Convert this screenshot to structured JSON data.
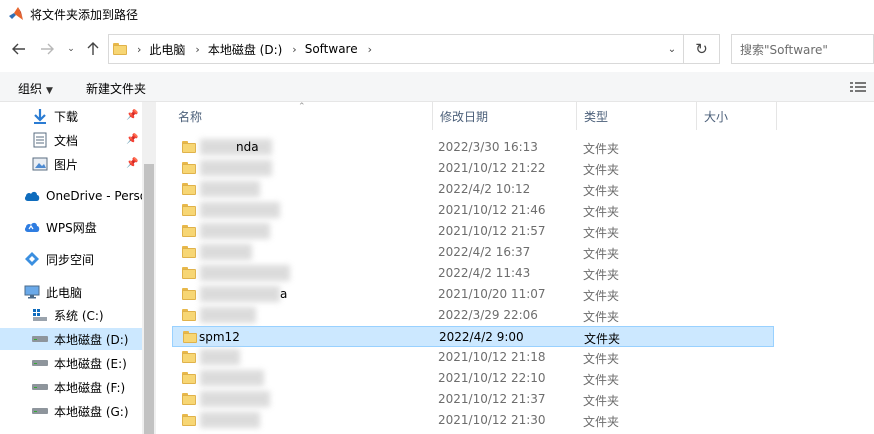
{
  "window": {
    "title": "将文件夹添加到路径"
  },
  "address": {
    "crumbs": [
      "此电脑",
      "本地磁盘 (D:)",
      "Software"
    ],
    "search_placeholder": "搜索\"Software\""
  },
  "toolbar": {
    "organize_label": "组织",
    "new_folder_label": "新建文件夹"
  },
  "nav": {
    "items": [
      {
        "label": "下载",
        "icon": "download-icon",
        "pinned": true
      },
      {
        "label": "文档",
        "icon": "document-icon",
        "pinned": true
      },
      {
        "label": "图片",
        "icon": "picture-icon",
        "pinned": true
      },
      {
        "label": "OneDrive - Perso",
        "icon": "cloud-icon"
      },
      {
        "label": "WPS网盘",
        "icon": "wps-cloud-icon"
      },
      {
        "label": "同步空间",
        "icon": "sync-icon"
      },
      {
        "label": "此电脑",
        "icon": "computer-icon"
      },
      {
        "label": "系统 (C:)",
        "icon": "system-drive-icon"
      },
      {
        "label": "本地磁盘 (D:)",
        "icon": "drive-icon",
        "selected": true
      },
      {
        "label": "本地磁盘 (E:)",
        "icon": "drive-icon"
      },
      {
        "label": "本地磁盘 (F:)",
        "icon": "drive-icon"
      },
      {
        "label": "本地磁盘 (G:)",
        "icon": "drive-icon"
      }
    ]
  },
  "columns": {
    "name": "名称",
    "modified": "修改日期",
    "type": "类型",
    "size": "大小"
  },
  "files": [
    {
      "name": "nda",
      "date": "2022/3/30 16:13",
      "type": "文件夹"
    },
    {
      "name": "",
      "date": "2021/10/12 21:22",
      "type": "文件夹"
    },
    {
      "name": "",
      "date": "2022/4/2 10:12",
      "type": "文件夹"
    },
    {
      "name": "",
      "date": "2021/10/12 21:46",
      "type": "文件夹"
    },
    {
      "name": "",
      "date": "2021/10/12 21:57",
      "type": "文件夹"
    },
    {
      "name": "",
      "date": "2022/4/2 16:37",
      "type": "文件夹"
    },
    {
      "name": "",
      "date": "2022/4/2 11:43",
      "type": "文件夹"
    },
    {
      "name": "a",
      "date": "2021/10/20 11:07",
      "type": "文件夹"
    },
    {
      "name": "",
      "date": "2022/3/29 22:06",
      "type": "文件夹"
    },
    {
      "name": "spm12",
      "date": "2022/4/2 9:00",
      "type": "文件夹",
      "selected": true
    },
    {
      "name": "",
      "date": "2021/10/12 21:18",
      "type": "文件夹"
    },
    {
      "name": "",
      "date": "2021/10/12 22:10",
      "type": "文件夹"
    },
    {
      "name": "",
      "date": "2021/10/12 21:37",
      "type": "文件夹"
    },
    {
      "name": "",
      "date": "2021/10/12 21:30",
      "type": "文件夹"
    }
  ],
  "colors": {
    "selection": "#cce8ff",
    "selection_border": "#99d1ff",
    "folder": "#f7d674",
    "header_text": "#4c607a"
  }
}
